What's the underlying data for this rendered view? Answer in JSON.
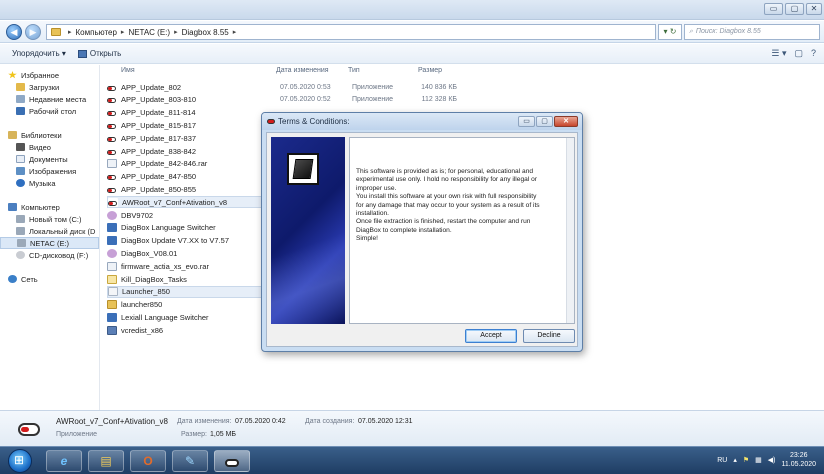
{
  "address": {
    "crumbs": [
      "Компьютер",
      "NETAC (E:)",
      "Diagbox 8.55"
    ],
    "search_placeholder": "Поиск: Diagbox 8.55"
  },
  "toolbar": {
    "organize": "Упорядочить ▾",
    "open": "Открыть"
  },
  "nav": {
    "favorites": "Избранное",
    "downloads": "Загрузки",
    "recent": "Недавние места",
    "desktop": "Рабочий стол",
    "libraries": "Библиотеки",
    "video": "Видео",
    "documents": "Документы",
    "images": "Изображения",
    "music": "Музыка",
    "computer": "Компьютер",
    "newvol": "Новый том (C:)",
    "localdisk": "Локальный диск (D",
    "netac": "NETAC (E:)",
    "cd": "CD-дисковод (F:)",
    "network": "Сеть"
  },
  "columns": {
    "name": "Имя",
    "date": "Дата изменения",
    "type": "Тип",
    "size": "Размер"
  },
  "files": [
    {
      "name": "APP_Update_802",
      "date": "07.05.2020 0:53",
      "type": "Приложение",
      "size": "140 836 КБ"
    },
    {
      "name": "APP_Update_803-810",
      "date": "07.05.2020 0:52",
      "type": "Приложение",
      "size": "112 328 КБ"
    },
    {
      "name": "APP_Update_811-814",
      "date": "",
      "type": "",
      "size": ""
    },
    {
      "name": "APP_Update_815-817",
      "date": "",
      "type": "",
      "size": ""
    },
    {
      "name": "APP_Update_817-837",
      "date": "",
      "type": "",
      "size": ""
    },
    {
      "name": "APP_Update_838-842",
      "date": "",
      "type": "",
      "size": ""
    },
    {
      "name": "APP_Update_842-846.rar",
      "date": "",
      "type": "",
      "size": ""
    },
    {
      "name": "APP_Update_847-850",
      "date": "",
      "type": "",
      "size": ""
    },
    {
      "name": "APP_Update_850-855",
      "date": "",
      "type": "",
      "size": ""
    },
    {
      "name": "AWRoot_v7_Conf+Ativation_v8",
      "date": "",
      "type": "",
      "size": ""
    },
    {
      "name": "DBV9702",
      "date": "",
      "type": "",
      "size": ""
    },
    {
      "name": "DiagBox Language Switcher",
      "date": "",
      "type": "",
      "size": ""
    },
    {
      "name": "DiagBox Update V7.XX to V7.57",
      "date": "",
      "type": "",
      "size": ""
    },
    {
      "name": "DiagBox_V08.01",
      "date": "",
      "type": "",
      "size": ""
    },
    {
      "name": "firmware_actia_xs_evo.rar",
      "date": "",
      "type": "",
      "size": ""
    },
    {
      "name": "Kill_DiagBox_Tasks",
      "date": "",
      "type": "",
      "size": ""
    },
    {
      "name": "Launcher_850",
      "date": "",
      "type": "",
      "size": ""
    },
    {
      "name": "launcher850",
      "date": "",
      "type": "",
      "size": ""
    },
    {
      "name": "Lexiall Language Switcher",
      "date": "",
      "type": "",
      "size": ""
    },
    {
      "name": "vcredist_x86",
      "date": "",
      "type": "",
      "size": ""
    }
  ],
  "dialog": {
    "title": "Terms & Conditions:",
    "lines": [
      "This software is provided as is; for personal, educational and",
      "experimental use only. I hold no responsibility for any illegal or",
      "improper use.",
      "You install this software at your own risk with full responsibility",
      "for any damage that may occur to your system as a result of its",
      "installation.",
      "Once file extraction is finished, restart the computer and run",
      "DiagBox to complete installation.",
      "Simple!"
    ],
    "accept": "Accept",
    "decline": "Decline"
  },
  "details": {
    "name": "AWRoot_v7_Conf+Ativation_v8",
    "modified_label": "Дата изменения:",
    "modified": "07.05.2020 0:42",
    "created_label": "Дата создания:",
    "created": "07.05.2020 12:31",
    "type": "Приложение",
    "size_label": "Размер:",
    "size": "1,05 МБ"
  },
  "tray": {
    "lang": "RU",
    "time": "23:26",
    "date": "11.05.2020"
  }
}
